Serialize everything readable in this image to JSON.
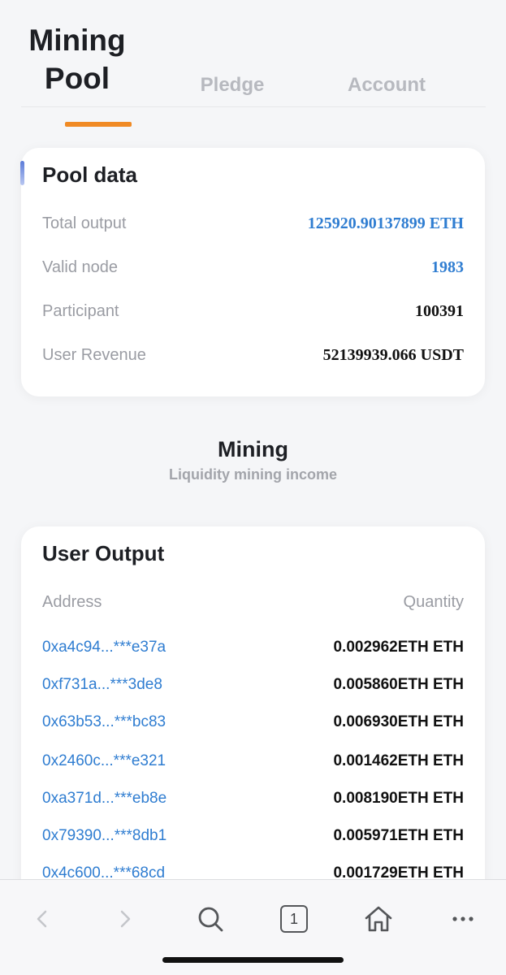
{
  "tabs": [
    {
      "label_line1": "Mining",
      "label_line2": "Pool",
      "active": true
    },
    {
      "label": "Pledge",
      "active": false
    },
    {
      "label": "Account",
      "active": false
    }
  ],
  "pool": {
    "title": "Pool data",
    "rows": [
      {
        "label": "Total output",
        "value": "125920.90137899 ETH"
      },
      {
        "label": "Valid node",
        "value": "1983"
      },
      {
        "label": "Participant",
        "value": "100391"
      },
      {
        "label": "User Revenue",
        "value": "52139939.066 USDT"
      }
    ]
  },
  "mining": {
    "title": "Mining",
    "subtitle": "Liquidity mining income"
  },
  "output": {
    "title": "User Output",
    "col_address": "Address",
    "col_quantity": "Quantity",
    "rows": [
      {
        "address": "0xa4c94...***e37a",
        "quantity": "0.002962ETH ETH"
      },
      {
        "address": "0xf731a...***3de8",
        "quantity": "0.005860ETH ETH"
      },
      {
        "address": "0x63b53...***bc83",
        "quantity": "0.006930ETH ETH"
      },
      {
        "address": "0x2460c...***e321",
        "quantity": "0.001462ETH ETH"
      },
      {
        "address": "0xa371d...***eb8e",
        "quantity": "0.008190ETH ETH"
      },
      {
        "address": "0x79390...***8db1",
        "quantity": "0.005971ETH ETH"
      },
      {
        "address": "0x4c600...***68cd",
        "quantity": "0.001729ETH ETH"
      }
    ]
  },
  "toolbar": {
    "tab_count": "1",
    "icons": [
      "back-icon",
      "forward-icon",
      "search-icon",
      "tabs-icon",
      "home-icon",
      "more-icon"
    ]
  },
  "colors": {
    "accent_orange": "#f08a24",
    "link_blue": "#2f7dd1"
  }
}
